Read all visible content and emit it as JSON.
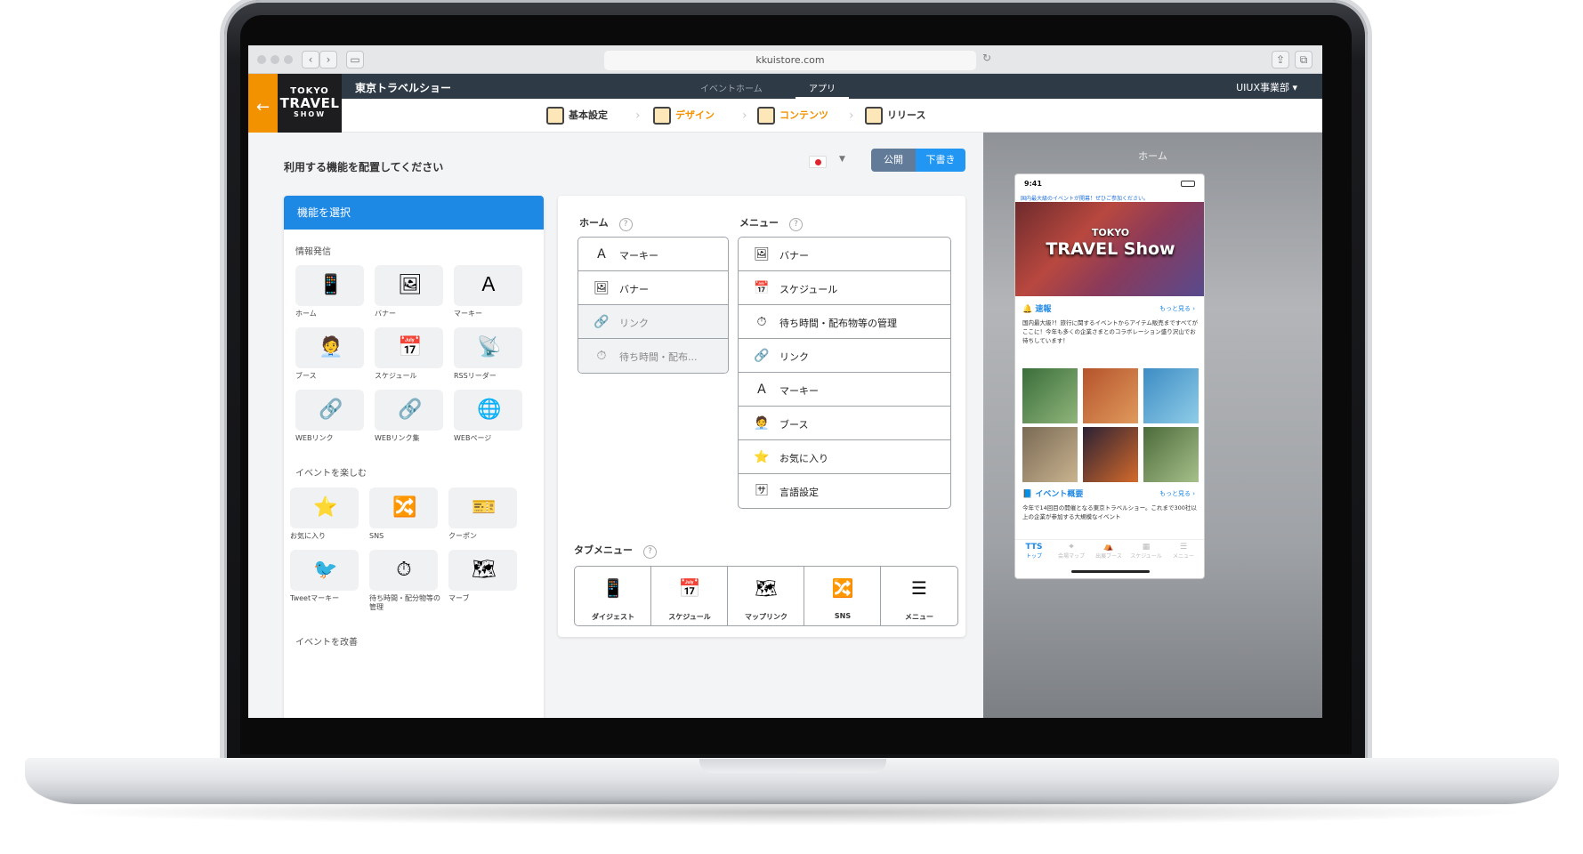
{
  "browser": {
    "url": "kkuistore.com",
    "back": "‹",
    "forward": "›"
  },
  "header": {
    "title": "東京トラベルショー",
    "tabs": [
      {
        "label": "イベントホーム",
        "active": false
      },
      {
        "label": "アプリ",
        "active": true
      }
    ],
    "department": "UIUX事業部 ▾",
    "back_arrow": "←",
    "logo": {
      "line1": "TOKYO",
      "line2": "TRAVEL",
      "line3": "SHOW"
    }
  },
  "steps": [
    {
      "label": "基本設定",
      "active": false
    },
    {
      "label": "デザイン",
      "active": true
    },
    {
      "label": "コンテンツ",
      "active": true
    },
    {
      "label": "リリース",
      "active": false
    }
  ],
  "work": {
    "instruction": "利用する機能を配置してください",
    "lang_caret": "▼",
    "publish_label": "公開",
    "draft_label": "下書き"
  },
  "feature_panel": {
    "title": "機能を選択",
    "groups": [
      {
        "label": "情報発信"
      },
      {
        "label": "イベントを楽しむ"
      },
      {
        "label": "イベントを改善"
      }
    ],
    "tiles": [
      {
        "label": "ホーム",
        "icon": "📱"
      },
      {
        "label": "バナー",
        "icon": "🖼"
      },
      {
        "label": "マーキー",
        "icon": "Ａ"
      },
      {
        "label": "ブース",
        "icon": "🧑‍💼"
      },
      {
        "label": "スケジュール",
        "icon": "📅"
      },
      {
        "label": "RSSリーダー",
        "icon": "📡"
      },
      {
        "label": "WEBリンク",
        "icon": "🔗"
      },
      {
        "label": "WEBリンク集",
        "icon": "🔗"
      },
      {
        "label": "WEBページ",
        "icon": "🌐"
      },
      {
        "label": "お気に入り",
        "icon": "⭐"
      },
      {
        "label": "SNS",
        "icon": "🔀"
      },
      {
        "label": "クーポン",
        "icon": "🎫"
      },
      {
        "label": "Tweetマーキー",
        "icon": "🐦"
      },
      {
        "label": "待ち時間・配分物等の管理",
        "icon": "⏱"
      },
      {
        "label": "マーブ",
        "icon": "🗺"
      }
    ]
  },
  "layout_panel": {
    "home_title": "ホーム",
    "menu_title": "メニュー",
    "tab_title": "タブメニュー",
    "help": "?",
    "home_rows": [
      {
        "label": "マーキー",
        "icon": "Ａ"
      },
      {
        "label": "バナー",
        "icon": "🖼"
      },
      {
        "label": "リンク",
        "icon": "🔗"
      },
      {
        "label": "待ち時間・配布...",
        "icon": "⏱"
      }
    ],
    "menu_rows": [
      {
        "label": "バナー",
        "icon": "🖼"
      },
      {
        "label": "スケジュール",
        "icon": "📅"
      },
      {
        "label": "待ち時間・配布物等の管理",
        "icon": "⏱"
      },
      {
        "label": "リンク",
        "icon": "🔗"
      },
      {
        "label": "マーキー",
        "icon": "Ａ"
      },
      {
        "label": "ブース",
        "icon": "🧑‍💼"
      },
      {
        "label": "お気に入り",
        "icon": "⭐"
      },
      {
        "label": "言語設定",
        "icon": "🈂"
      }
    ],
    "tabs": [
      {
        "label": "ダイジェスト",
        "icon": "📱"
      },
      {
        "label": "スケジュール",
        "icon": "📅"
      },
      {
        "label": "マップリンク",
        "icon": "🗺"
      },
      {
        "label": "SNS",
        "icon": "🔀"
      },
      {
        "label": "メニュー",
        "icon": "☰"
      }
    ]
  },
  "preview": {
    "title": "ホーム",
    "time": "9:41",
    "notice": "国内最大級のイベントが開幕！ぜひご参加ください。",
    "hero_line1": "TOKYO",
    "hero_line2": "TRAVEL Show",
    "news_title": "速報",
    "more": "もっと見る ›",
    "news_text": "国内最大級?！旅行に関するイベントからアイテム販売まですべてがここに！今年も多くの企業さまとのコラボレーション盛り沢山でお待ちしています！",
    "overview_title": "イベント概要",
    "overview_text": "今年で14回目の開催となる東京トラベルショー。これまで300社以上の企業が参加する大規模なイベント",
    "tab_brand": "TTS",
    "tabs": [
      {
        "label": "トップ",
        "active": true
      },
      {
        "label": "会場マップ",
        "active": false
      },
      {
        "label": "出展ブース",
        "active": false
      },
      {
        "label": "スケジュール",
        "active": false
      },
      {
        "label": "メニュー",
        "active": false
      }
    ]
  }
}
